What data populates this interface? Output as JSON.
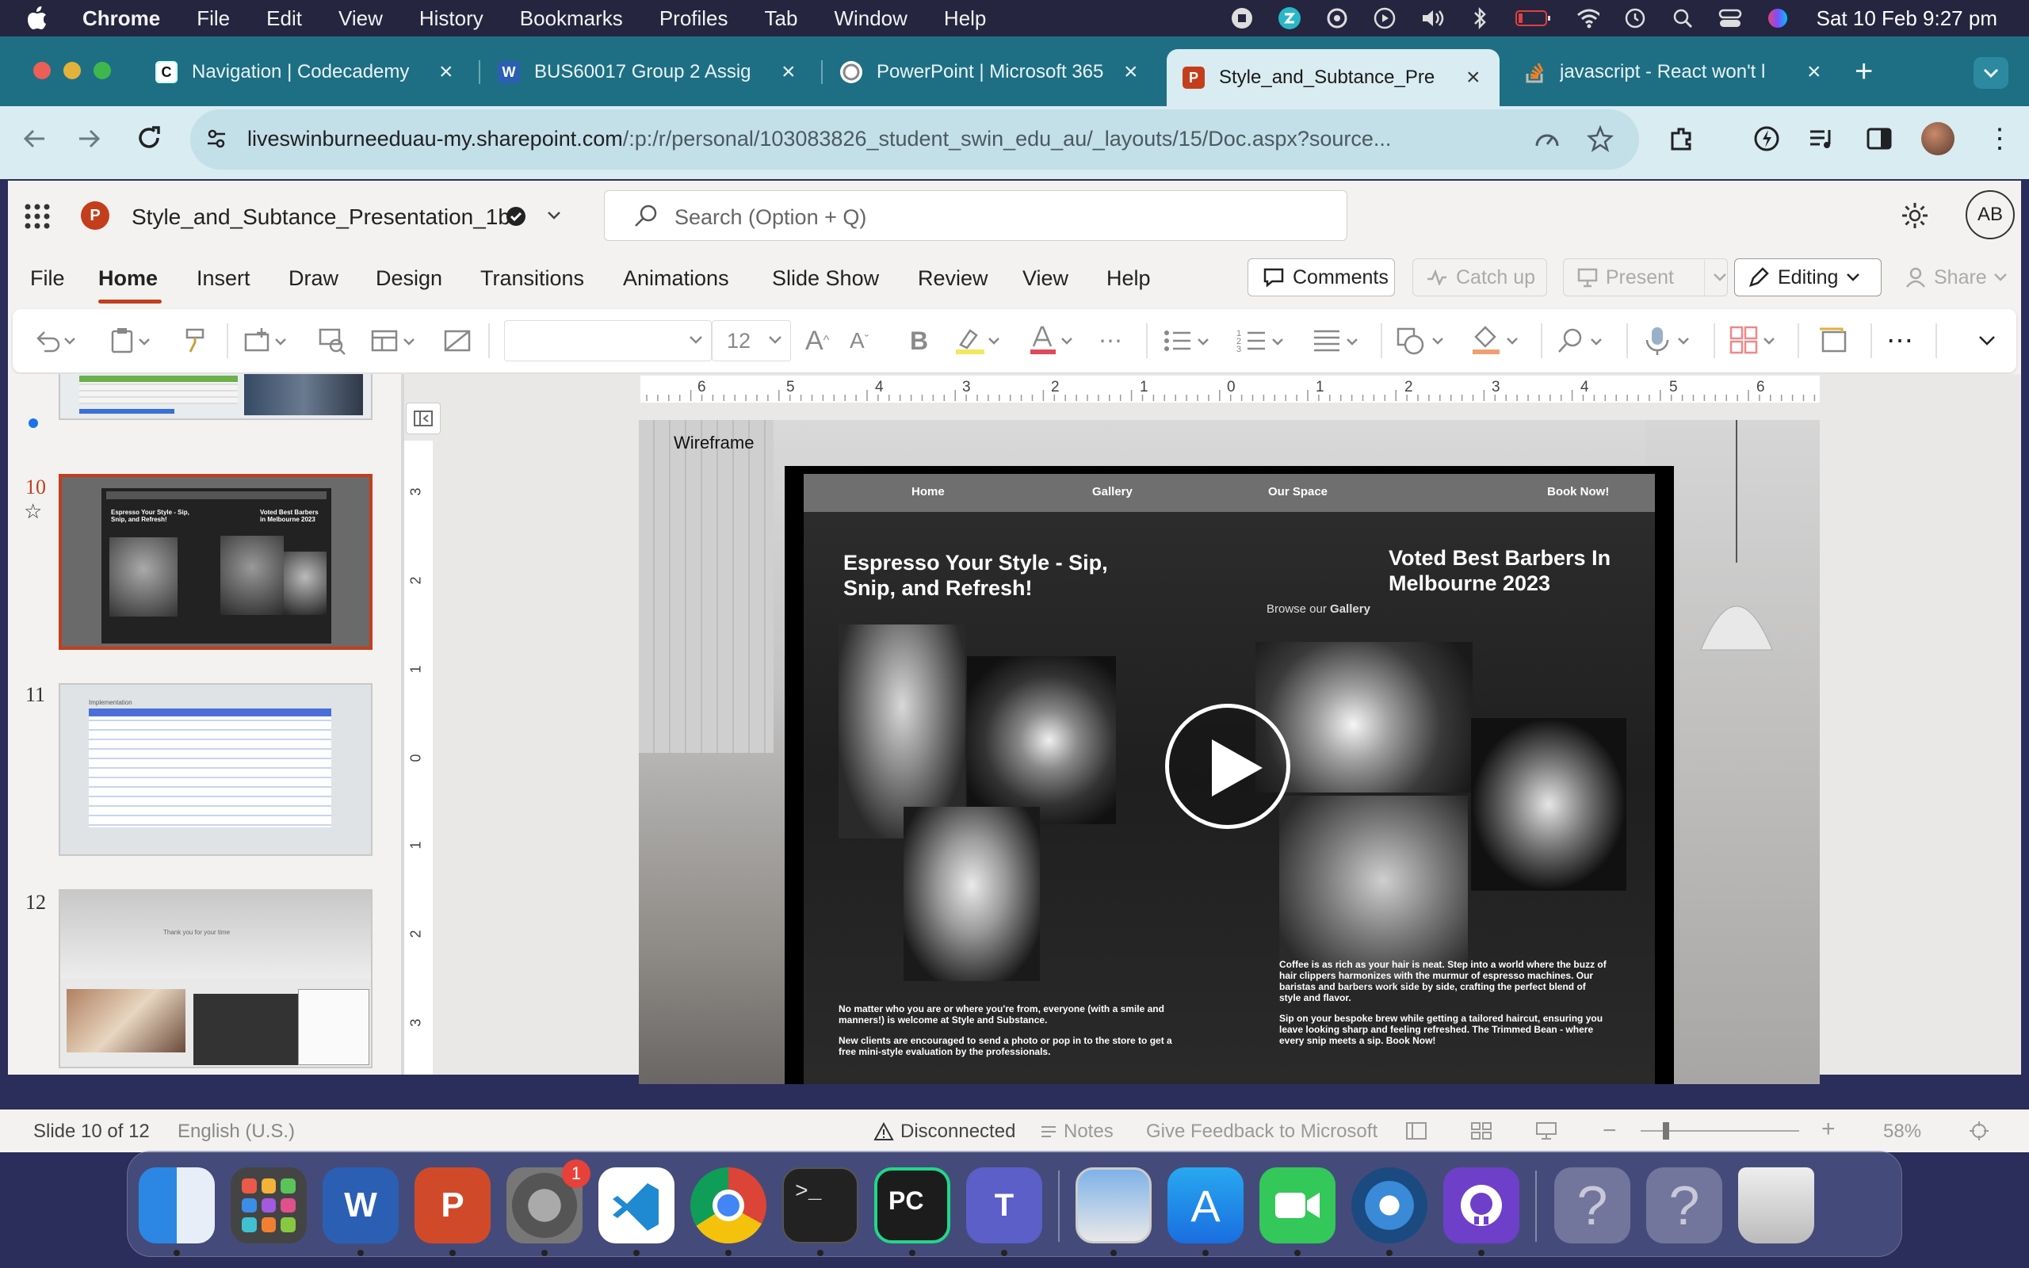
{
  "menubar": {
    "app_name": "Chrome",
    "items": [
      "File",
      "Edit",
      "View",
      "History",
      "Bookmarks",
      "Profiles",
      "Tab",
      "Window",
      "Help"
    ],
    "datetime": "Sat 10 Feb  9:27 pm"
  },
  "tabs": [
    {
      "title": "Navigation | Codecademy",
      "favicon": "codecademy-icon"
    },
    {
      "title": "BUS60017 Group 2 Assig",
      "favicon": "word-icon"
    },
    {
      "title": "PowerPoint | Microsoft 365",
      "favicon": "office-icon"
    },
    {
      "title": "Style_and_Subtance_Pre",
      "favicon": "powerpoint-icon",
      "active": true
    },
    {
      "title": "javascript - React won't l",
      "favicon": "stackoverflow-icon"
    }
  ],
  "address": {
    "host": "liveswinburneeduau-my.sharepoint.com",
    "path": "/:p:/r/personal/103083826_student_swin_edu_au/_layouts/15/Doc.aspx?source..."
  },
  "app": {
    "file_name": "Style_and_Subtance_Presentation_1b",
    "search_placeholder": "Search (Option + Q)",
    "avatar_initials": "AB",
    "ribbon_tabs": [
      "File",
      "Home",
      "Insert",
      "Draw",
      "Design",
      "Transitions",
      "Animations",
      "Slide Show",
      "Review",
      "View",
      "Help"
    ],
    "active_ribbon_tab": "Home",
    "comments_label": "Comments",
    "catchup_label": "Catch up",
    "present_label": "Present",
    "editing_label": "Editing",
    "share_label": "Share",
    "font_size": "12"
  },
  "thumbnails": {
    "numbers": [
      "10",
      "11",
      "12"
    ],
    "t10_left": "Espresso Your Style - Sip, Snip, and Refresh!",
    "t10_right": "Voted Best Barbers in Melbourne 2023",
    "t11_title": "Implementation",
    "t12_caption": "Thank you for your time"
  },
  "ruler": {
    "h_labels": [
      "6",
      "5",
      "4",
      "3",
      "2",
      "1",
      "0",
      "1",
      "2",
      "3",
      "4",
      "5",
      "6"
    ],
    "v_labels": [
      "3",
      "2",
      "1",
      "0",
      "1",
      "2",
      "3"
    ]
  },
  "slide": {
    "label": "Wireframe",
    "nav": [
      "Home",
      "Gallery",
      "Our Space",
      "Book Now!"
    ],
    "headline_left": "Espresso Your Style - Sip, Snip, and Refresh!",
    "headline_right": "Voted Best Barbers In Melbourne 2023",
    "browse_prefix": "Browse our",
    "browse_link": "Gallery",
    "left_para1": "No matter who you are or where you're from, everyone (with a smile and manners!) is welcome at Style and Substance.",
    "left_para2": "New clients are encouraged to send a photo or pop in to the store to get a free mini-style evaluation by the professionals.",
    "right_para1": "Coffee is as rich as your hair is neat. Step into a world where the buzz of hair clippers harmonizes with the murmur of espresso machines. Our baristas and barbers work side by side, crafting the perfect blend of style and flavor.",
    "right_para2": "Sip on your bespoke brew while getting a tailored haircut, ensuring you leave looking sharp and feeling refreshed. The Trimmed Bean - where every snip meets a sip. Book Now!"
  },
  "status": {
    "slide_counter": "Slide 10 of 12",
    "language": "English (U.S.)",
    "connection": "Disconnected",
    "notes": "Notes",
    "feedback": "Give Feedback to Microsoft",
    "zoom": "58%"
  },
  "dock": {
    "apps": [
      "finder",
      "launchpad",
      "word",
      "powerpoint",
      "system-settings",
      "vscode",
      "chrome",
      "terminal",
      "pycharm",
      "teams",
      "preview",
      "app-store",
      "facetime",
      "safari-vpn",
      "github",
      "help-1",
      "help-2",
      "trash"
    ],
    "badge": "1"
  },
  "colors": {
    "tabbar": "#1e6f84",
    "accent_red": "#c43e1c",
    "active_tab_underline": "#c43e1c"
  }
}
